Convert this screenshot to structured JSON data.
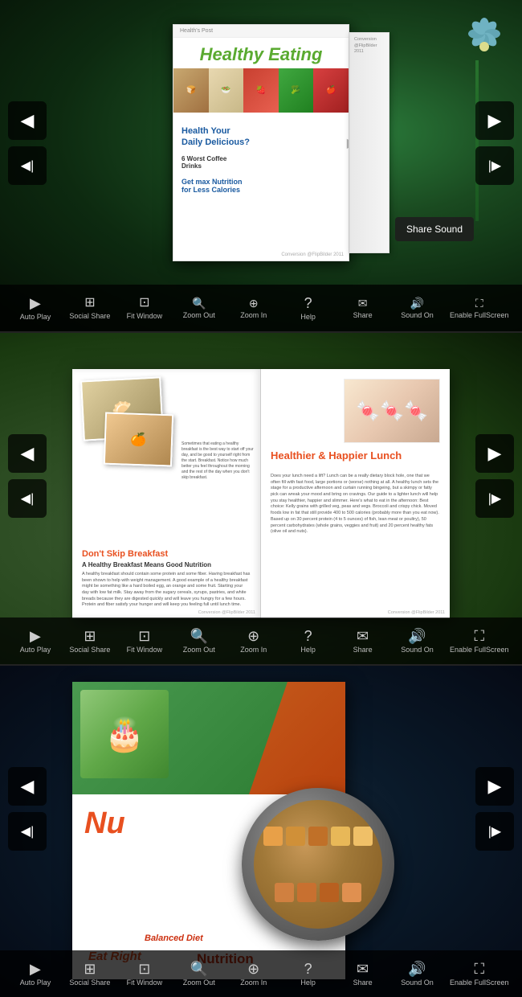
{
  "sections": [
    {
      "id": "section1",
      "bg": "bg1",
      "book": {
        "header": "Health's Post",
        "title": "Healthy Eating",
        "subtitle": "Health Your\nDaily Delicious?",
        "items": [
          "6 Worst Coffee Drinks",
          "Get max Nutrition\nfor Less Calories"
        ],
        "footer": "Conversion @FlipBilder 2011"
      },
      "toolbar": {
        "items": [
          {
            "label": "Auto Play",
            "icon": "▶"
          },
          {
            "label": "Social Share",
            "icon": "⊞"
          },
          {
            "label": "Fit Window",
            "icon": "⊡"
          },
          {
            "label": "Zoom Out",
            "icon": "🔍"
          },
          {
            "label": "Zoom In",
            "icon": "🔍"
          },
          {
            "label": "Help",
            "icon": "?"
          },
          {
            "label": "Share",
            "icon": "✉"
          },
          {
            "label": "Sound On",
            "icon": "🔊"
          },
          {
            "label": "Enable FullScreen",
            "icon": "⊡"
          }
        ]
      },
      "shareSoundPopup": "Share Sound"
    },
    {
      "id": "section2",
      "bg": "bg2",
      "leftPage": {
        "heading": "Don't Skip Breakfast",
        "subheading": "A Healthy Breakfast\nMeans Good Nutrition",
        "body": "A healthy breakfast should contain some protein and some fiber. Having breakfast has been shown to help with weight management. A good example of a healthy breakfast might be something like a hard boiled egg, an orange and some fruit. Starting your day with low fat milk. Stay away from the sugary cereals, syrups, pastries, and white breads because they are digested quickly and will leave you hungry for a few hours. Protein and fiber satisfy your hunger and will keep you feeling full until lunch time.",
        "sometimes": "Sometimes that eating a healthy breakfast is the best way to start off your day, and be good to yourself right from the start. Breakfast. Notice how much better you feel throughout the morning and the rest of the day when you don't skip breakfast."
      },
      "rightPage": {
        "title": "Healthier & Happier Lunch",
        "body": "Does your lunch need a lift? Lunch can be a really dietary block hole, one that we often fill with fast food, large portions or (worse) nothing at all. A healthy lunch sets the stage for a productive afternoon and curtain running bingeing, but a skimpy or fatty pick can wreak your mood and bring on cravings. Our guide to a lighter lunch will help you stay healthier, happier and slimmer. Here's what to eat in the afternoon: Best choice: Kelly grains with grilled veg, peas and vegs. Broccoli and crispy chick. Moved foods low in fat that still provide 400 to 500 calories (probably more than you eat now). Based up on 30 percent protein (4 to 5 ounces) of fish, lean meat or poultry), 50 percent carbohydrates (whole grains, veggies and fruit) and 20 percent healthy fats (olive oil and nuts)."
      },
      "toolbar": {
        "items": [
          {
            "label": "Auto Play",
            "icon": "▶"
          },
          {
            "label": "Social Share",
            "icon": "⊞"
          },
          {
            "label": "Fit Window",
            "icon": "⊡"
          },
          {
            "label": "Zoom Out",
            "icon": "🔍"
          },
          {
            "label": "Zoom In",
            "icon": "🔍"
          },
          {
            "label": "Help",
            "icon": "?"
          },
          {
            "label": "Share",
            "icon": "✉"
          },
          {
            "label": "Sound On",
            "icon": "🔊"
          },
          {
            "label": "Enable FullScreen",
            "icon": "⊡"
          }
        ]
      }
    },
    {
      "id": "section3",
      "bg": "bg3",
      "book": {
        "nu": "Nu",
        "eatRight": "Eat Right",
        "balancedDiet": "Balanced Diet",
        "nutrition": "Nutrition"
      },
      "toolbar": {
        "items": [
          {
            "label": "Auto Play",
            "icon": "▶"
          },
          {
            "label": "Social Share",
            "icon": "⊞"
          },
          {
            "label": "Fit Window",
            "icon": "⊡"
          },
          {
            "label": "Zoom Out",
            "icon": "🔍"
          },
          {
            "label": "Zoom In",
            "icon": "🔍"
          },
          {
            "label": "Help",
            "icon": "?"
          },
          {
            "label": "Share",
            "icon": "✉"
          },
          {
            "label": "Sound On",
            "icon": "🔊"
          },
          {
            "label": "Enable FullScreen",
            "icon": "⊡"
          }
        ]
      }
    }
  ],
  "nav": {
    "prevLabel": "◀",
    "nextLabel": "▶",
    "firstLabel": "◀◀",
    "lastLabel": "▶▶"
  },
  "toolbar": {
    "autoPlay": "Auto Play",
    "socialShare": "Social Share",
    "fitWindow": "Fit Window",
    "zoomOut": "Zoom Out",
    "zoomIn": "Zoom In",
    "help": "Help",
    "share": "Share",
    "soundOn": "Sound On",
    "enableFullscreen": "Enable FullScreen"
  },
  "shareSoundText": "Share Sound"
}
